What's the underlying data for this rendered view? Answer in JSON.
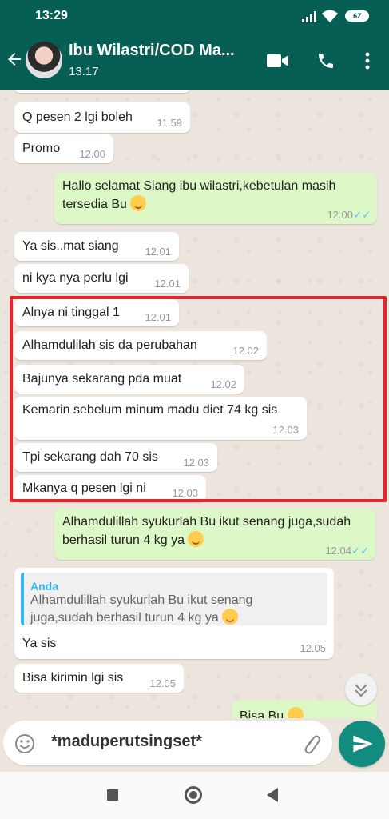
{
  "status_bar": {
    "time": "13:29",
    "battery": "67"
  },
  "header": {
    "contact_name": "Ibu Wilastri/COD Ma...",
    "subtitle": "13.17"
  },
  "messages": [
    {
      "text": "Q pesen 2 lgi boleh",
      "time": "11.59"
    },
    {
      "text": "Promo",
      "time": "12.00"
    },
    {
      "text": "Hallo selamat Siang ibu wilastri,kebetulan masih tersedia Bu",
      "time": "12.00"
    },
    {
      "text": "Ya sis..mat siang",
      "time": "12.01"
    },
    {
      "text": "ni kya nya perlu lgi",
      "time": "12.01"
    },
    {
      "text": "Alnya ni tinggal 1",
      "time": "12.01"
    },
    {
      "text": "Alhamdulilah sis da perubahan",
      "time": "12.02"
    },
    {
      "text": "Bajunya sekarang pda muat",
      "time": "12.02"
    },
    {
      "text": "Kemarin sebelum minum madu diet 74 kg sis",
      "time": "12.03"
    },
    {
      "text": "Tpi sekarang dah 70 sis",
      "time": "12.03"
    },
    {
      "text": "Mkanya q pesen lgi ni",
      "time": "12.03"
    },
    {
      "text": "Alhamdulillah syukurlah Bu ikut senang juga,sudah berhasil turun 4 kg ya",
      "time": "12.04"
    },
    {
      "quote_name": "Anda",
      "quote_text": "Alhamdulillah syukurlah Bu ikut senang juga,sudah berhasil turun 4 kg ya",
      "text": "Ya sis",
      "time": "12.05"
    },
    {
      "text": "Bisa kirimin lgi sis",
      "time": "12.05"
    },
    {
      "text": "Bisa Bu"
    }
  ],
  "input": {
    "value": "*maduperutsingset*"
  },
  "colors": {
    "header": "#075e54",
    "outgoing": "#dcf8c6",
    "incoming": "#ffffff",
    "highlight_box": "#e3262e",
    "send": "#128c7e",
    "ticks": "#4fc3f7"
  },
  "icons": [
    "back-arrow-icon",
    "video-call-icon",
    "phone-icon",
    "more-options-icon",
    "emoji-icon",
    "attach-icon",
    "send-icon",
    "scroll-down-icon",
    "nav-recent-icon",
    "nav-home-icon",
    "nav-back-icon"
  ]
}
